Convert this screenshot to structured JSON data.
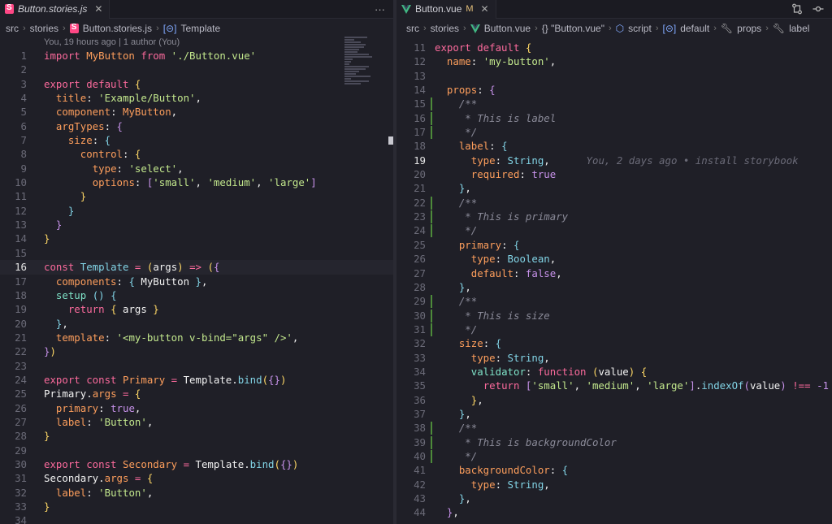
{
  "left": {
    "tab": {
      "label": "Button.stories.js",
      "more": "···"
    },
    "breadcrumb": [
      "src",
      "stories",
      "Button.stories.js",
      "Template"
    ],
    "blame": "You, 19 hours ago | 1 author (You)",
    "lines": [
      {
        "n": "1",
        "tokens": [
          [
            "k",
            "import "
          ],
          [
            "p",
            "MyButton"
          ],
          [
            "k",
            " from "
          ],
          [
            "s",
            "'./Button.vue'"
          ]
        ]
      },
      {
        "n": "2",
        "tokens": []
      },
      {
        "n": "3",
        "tokens": [
          [
            "k",
            "export default "
          ],
          [
            "y",
            "{"
          ]
        ]
      },
      {
        "n": "4",
        "tokens": [
          [
            "v",
            "  "
          ],
          [
            "p",
            "title"
          ],
          [
            "v",
            ": "
          ],
          [
            "s",
            "'Example/Button'"
          ],
          [
            "v",
            ","
          ]
        ]
      },
      {
        "n": "5",
        "tokens": [
          [
            "v",
            "  "
          ],
          [
            "p",
            "component"
          ],
          [
            "v",
            ": "
          ],
          [
            "p",
            "MyButton"
          ],
          [
            "v",
            ","
          ]
        ]
      },
      {
        "n": "6",
        "tokens": [
          [
            "v",
            "  "
          ],
          [
            "p",
            "argTypes"
          ],
          [
            "v",
            ": "
          ],
          [
            "pu",
            "{"
          ]
        ]
      },
      {
        "n": "7",
        "tokens": [
          [
            "v",
            "    "
          ],
          [
            "p",
            "size"
          ],
          [
            "v",
            ": "
          ],
          [
            "f",
            "{"
          ]
        ]
      },
      {
        "n": "8",
        "tokens": [
          [
            "v",
            "      "
          ],
          [
            "p",
            "control"
          ],
          [
            "v",
            ": "
          ],
          [
            "y",
            "{"
          ]
        ]
      },
      {
        "n": "9",
        "tokens": [
          [
            "v",
            "        "
          ],
          [
            "p",
            "type"
          ],
          [
            "v",
            ": "
          ],
          [
            "s",
            "'select'"
          ],
          [
            "v",
            ","
          ]
        ]
      },
      {
        "n": "10",
        "tokens": [
          [
            "v",
            "        "
          ],
          [
            "p",
            "options"
          ],
          [
            "v",
            ": "
          ],
          [
            "pu",
            "["
          ],
          [
            "s",
            "'small'"
          ],
          [
            "v",
            ", "
          ],
          [
            "s",
            "'medium'"
          ],
          [
            "v",
            ", "
          ],
          [
            "s",
            "'large'"
          ],
          [
            "pu",
            "]"
          ]
        ]
      },
      {
        "n": "11",
        "tokens": [
          [
            "v",
            "      "
          ],
          [
            "y",
            "}"
          ]
        ]
      },
      {
        "n": "12",
        "tokens": [
          [
            "v",
            "    "
          ],
          [
            "f",
            "}"
          ]
        ]
      },
      {
        "n": "13",
        "tokens": [
          [
            "v",
            "  "
          ],
          [
            "pu",
            "}"
          ]
        ]
      },
      {
        "n": "14",
        "tokens": [
          [
            "y",
            "}"
          ]
        ]
      },
      {
        "n": "15",
        "tokens": []
      },
      {
        "n": "16",
        "cur": true,
        "tokens": [
          [
            "k",
            "const "
          ],
          [
            "f",
            "Template"
          ],
          [
            "k",
            " = "
          ],
          [
            "y",
            "("
          ],
          [
            "v",
            "args"
          ],
          [
            "y",
            ")"
          ],
          [
            "k",
            " => "
          ],
          [
            "y",
            "("
          ],
          [
            "pu",
            "{"
          ]
        ]
      },
      {
        "n": "17",
        "tokens": [
          [
            "v",
            "  "
          ],
          [
            "p",
            "components"
          ],
          [
            "v",
            ": "
          ],
          [
            "f",
            "{"
          ],
          [
            "v",
            " MyButton "
          ],
          [
            "f",
            "}"
          ],
          [
            "v",
            ","
          ]
        ]
      },
      {
        "n": "18",
        "tokens": [
          [
            "v",
            "  "
          ],
          [
            "t",
            "setup"
          ],
          [
            "v",
            " "
          ],
          [
            "f",
            "()"
          ],
          [
            "v",
            " "
          ],
          [
            "f",
            "{"
          ]
        ]
      },
      {
        "n": "19",
        "tokens": [
          [
            "v",
            "    "
          ],
          [
            "k",
            "return "
          ],
          [
            "y",
            "{"
          ],
          [
            "v",
            " args "
          ],
          [
            "y",
            "}"
          ]
        ]
      },
      {
        "n": "20",
        "tokens": [
          [
            "v",
            "  "
          ],
          [
            "f",
            "}"
          ],
          [
            "v",
            ","
          ]
        ]
      },
      {
        "n": "21",
        "tokens": [
          [
            "v",
            "  "
          ],
          [
            "p",
            "template"
          ],
          [
            "v",
            ": "
          ],
          [
            "s",
            "'<my-button v-bind=\"args\" />'"
          ],
          [
            "v",
            ","
          ]
        ]
      },
      {
        "n": "22",
        "tokens": [
          [
            "pu",
            "}"
          ],
          [
            "y",
            ")"
          ]
        ]
      },
      {
        "n": "23",
        "tokens": []
      },
      {
        "n": "24",
        "tokens": [
          [
            "k",
            "export const "
          ],
          [
            "p",
            "Primary"
          ],
          [
            "k",
            " = "
          ],
          [
            "v",
            "Template."
          ],
          [
            "f",
            "bind"
          ],
          [
            "y",
            "("
          ],
          [
            "pu",
            "{}"
          ],
          [
            "y",
            ")"
          ]
        ]
      },
      {
        "n": "25",
        "tokens": [
          [
            "v",
            "Primary."
          ],
          [
            "p",
            "args"
          ],
          [
            "k",
            " = "
          ],
          [
            "y",
            "{"
          ]
        ]
      },
      {
        "n": "26",
        "tokens": [
          [
            "v",
            "  "
          ],
          [
            "p",
            "primary"
          ],
          [
            "v",
            ": "
          ],
          [
            "pu",
            "true"
          ],
          [
            "v",
            ","
          ]
        ]
      },
      {
        "n": "27",
        "tokens": [
          [
            "v",
            "  "
          ],
          [
            "p",
            "label"
          ],
          [
            "v",
            ": "
          ],
          [
            "s",
            "'Button'"
          ],
          [
            "v",
            ","
          ]
        ]
      },
      {
        "n": "28",
        "tokens": [
          [
            "y",
            "}"
          ]
        ]
      },
      {
        "n": "29",
        "tokens": []
      },
      {
        "n": "30",
        "tokens": [
          [
            "k",
            "export const "
          ],
          [
            "p",
            "Secondary"
          ],
          [
            "k",
            " = "
          ],
          [
            "v",
            "Template."
          ],
          [
            "f",
            "bind"
          ],
          [
            "y",
            "("
          ],
          [
            "pu",
            "{}"
          ],
          [
            "y",
            ")"
          ]
        ]
      },
      {
        "n": "31",
        "tokens": [
          [
            "v",
            "Secondary."
          ],
          [
            "p",
            "args"
          ],
          [
            "k",
            " = "
          ],
          [
            "y",
            "{"
          ]
        ]
      },
      {
        "n": "32",
        "tokens": [
          [
            "v",
            "  "
          ],
          [
            "p",
            "label"
          ],
          [
            "v",
            ": "
          ],
          [
            "s",
            "'Button'"
          ],
          [
            "v",
            ","
          ]
        ]
      },
      {
        "n": "33",
        "tokens": [
          [
            "y",
            "}"
          ]
        ]
      },
      {
        "n": "34",
        "tokens": []
      }
    ]
  },
  "right": {
    "tab": {
      "label": "Button.vue",
      "modified": "M"
    },
    "breadcrumb": [
      "src",
      "stories",
      "Button.vue",
      "{} \"Button.vue\"",
      "script",
      "default",
      "props",
      "label"
    ],
    "blame_inline": "You, 2 days ago • install storybook",
    "lines": [
      {
        "n": "11",
        "tokens": [
          [
            "k",
            "export default "
          ],
          [
            "y",
            "{"
          ]
        ]
      },
      {
        "n": "12",
        "tokens": [
          [
            "v",
            "  "
          ],
          [
            "p",
            "name"
          ],
          [
            "v",
            ": "
          ],
          [
            "s",
            "'my-button'"
          ],
          [
            "v",
            ","
          ]
        ]
      },
      {
        "n": "13",
        "tokens": []
      },
      {
        "n": "14",
        "tokens": [
          [
            "v",
            "  "
          ],
          [
            "p",
            "props"
          ],
          [
            "v",
            ": "
          ],
          [
            "pu",
            "{"
          ]
        ]
      },
      {
        "n": "15",
        "g": true,
        "tokens": [
          [
            "c",
            "    /**"
          ]
        ]
      },
      {
        "n": "16",
        "g": true,
        "tokens": [
          [
            "c",
            "     * This is label"
          ]
        ]
      },
      {
        "n": "17",
        "g": true,
        "tokens": [
          [
            "c",
            "     */"
          ]
        ]
      },
      {
        "n": "18",
        "tokens": [
          [
            "v",
            "    "
          ],
          [
            "p",
            "label"
          ],
          [
            "v",
            ": "
          ],
          [
            "f",
            "{"
          ]
        ]
      },
      {
        "n": "19",
        "cur": true,
        "blame": true,
        "tokens": [
          [
            "v",
            "      "
          ],
          [
            "p",
            "type"
          ],
          [
            "v",
            ": "
          ],
          [
            "f",
            "String"
          ],
          [
            "v",
            ","
          ]
        ]
      },
      {
        "n": "20",
        "tokens": [
          [
            "v",
            "      "
          ],
          [
            "p",
            "required"
          ],
          [
            "v",
            ": "
          ],
          [
            "pu",
            "true"
          ]
        ]
      },
      {
        "n": "21",
        "tokens": [
          [
            "v",
            "    "
          ],
          [
            "f",
            "}"
          ],
          [
            "v",
            ","
          ]
        ]
      },
      {
        "n": "22",
        "g": true,
        "tokens": [
          [
            "c",
            "    /**"
          ]
        ]
      },
      {
        "n": "23",
        "g": true,
        "tokens": [
          [
            "c",
            "     * This is primary"
          ]
        ]
      },
      {
        "n": "24",
        "g": true,
        "tokens": [
          [
            "c",
            "     */"
          ]
        ]
      },
      {
        "n": "25",
        "tokens": [
          [
            "v",
            "    "
          ],
          [
            "p",
            "primary"
          ],
          [
            "v",
            ": "
          ],
          [
            "f",
            "{"
          ]
        ]
      },
      {
        "n": "26",
        "tokens": [
          [
            "v",
            "      "
          ],
          [
            "p",
            "type"
          ],
          [
            "v",
            ": "
          ],
          [
            "f",
            "Boolean"
          ],
          [
            "v",
            ","
          ]
        ]
      },
      {
        "n": "27",
        "tokens": [
          [
            "v",
            "      "
          ],
          [
            "p",
            "default"
          ],
          [
            "v",
            ": "
          ],
          [
            "pu",
            "false"
          ],
          [
            "v",
            ","
          ]
        ]
      },
      {
        "n": "28",
        "tokens": [
          [
            "v",
            "    "
          ],
          [
            "f",
            "}"
          ],
          [
            "v",
            ","
          ]
        ]
      },
      {
        "n": "29",
        "g": true,
        "tokens": [
          [
            "c",
            "    /**"
          ]
        ]
      },
      {
        "n": "30",
        "g": true,
        "tokens": [
          [
            "c",
            "     * This is size"
          ]
        ]
      },
      {
        "n": "31",
        "g": true,
        "tokens": [
          [
            "c",
            "     */"
          ]
        ]
      },
      {
        "n": "32",
        "tokens": [
          [
            "v",
            "    "
          ],
          [
            "p",
            "size"
          ],
          [
            "v",
            ": "
          ],
          [
            "f",
            "{"
          ]
        ]
      },
      {
        "n": "33",
        "tokens": [
          [
            "v",
            "      "
          ],
          [
            "p",
            "type"
          ],
          [
            "v",
            ": "
          ],
          [
            "f",
            "String"
          ],
          [
            "v",
            ","
          ]
        ]
      },
      {
        "n": "34",
        "tokens": [
          [
            "v",
            "      "
          ],
          [
            "t",
            "validator"
          ],
          [
            "v",
            ": "
          ],
          [
            "k",
            "function "
          ],
          [
            "y",
            "("
          ],
          [
            "v",
            "value"
          ],
          [
            "y",
            ")"
          ],
          [
            "v",
            " "
          ],
          [
            "y",
            "{"
          ]
        ]
      },
      {
        "n": "35",
        "tokens": [
          [
            "v",
            "        "
          ],
          [
            "k",
            "return "
          ],
          [
            "pu",
            "["
          ],
          [
            "s",
            "'small'"
          ],
          [
            "v",
            ", "
          ],
          [
            "s",
            "'medium'"
          ],
          [
            "v",
            ", "
          ],
          [
            "s",
            "'large'"
          ],
          [
            "pu",
            "]"
          ],
          [
            "v",
            "."
          ],
          [
            "f",
            "indexOf"
          ],
          [
            "pu",
            "("
          ],
          [
            "v",
            "value"
          ],
          [
            "pu",
            ")"
          ],
          [
            "k",
            " !== "
          ],
          [
            "pu",
            "-1"
          ]
        ]
      },
      {
        "n": "36",
        "tokens": [
          [
            "v",
            "      "
          ],
          [
            "y",
            "}"
          ],
          [
            "v",
            ","
          ]
        ]
      },
      {
        "n": "37",
        "tokens": [
          [
            "v",
            "    "
          ],
          [
            "f",
            "}"
          ],
          [
            "v",
            ","
          ]
        ]
      },
      {
        "n": "38",
        "g": true,
        "tokens": [
          [
            "c",
            "    /**"
          ]
        ]
      },
      {
        "n": "39",
        "g": true,
        "tokens": [
          [
            "c",
            "     * This is backgroundColor"
          ]
        ]
      },
      {
        "n": "40",
        "g": true,
        "tokens": [
          [
            "c",
            "     */"
          ]
        ]
      },
      {
        "n": "41",
        "tokens": [
          [
            "v",
            "    "
          ],
          [
            "p",
            "backgroundColor"
          ],
          [
            "v",
            ": "
          ],
          [
            "f",
            "{"
          ]
        ]
      },
      {
        "n": "42",
        "tokens": [
          [
            "v",
            "      "
          ],
          [
            "p",
            "type"
          ],
          [
            "v",
            ": "
          ],
          [
            "f",
            "String"
          ],
          [
            "v",
            ","
          ]
        ]
      },
      {
        "n": "43",
        "tokens": [
          [
            "v",
            "    "
          ],
          [
            "f",
            "}"
          ],
          [
            "v",
            ","
          ]
        ]
      },
      {
        "n": "44",
        "tokens": [
          [
            "v",
            "  "
          ],
          [
            "pu",
            "}"
          ],
          [
            "v",
            ","
          ]
        ]
      }
    ]
  }
}
